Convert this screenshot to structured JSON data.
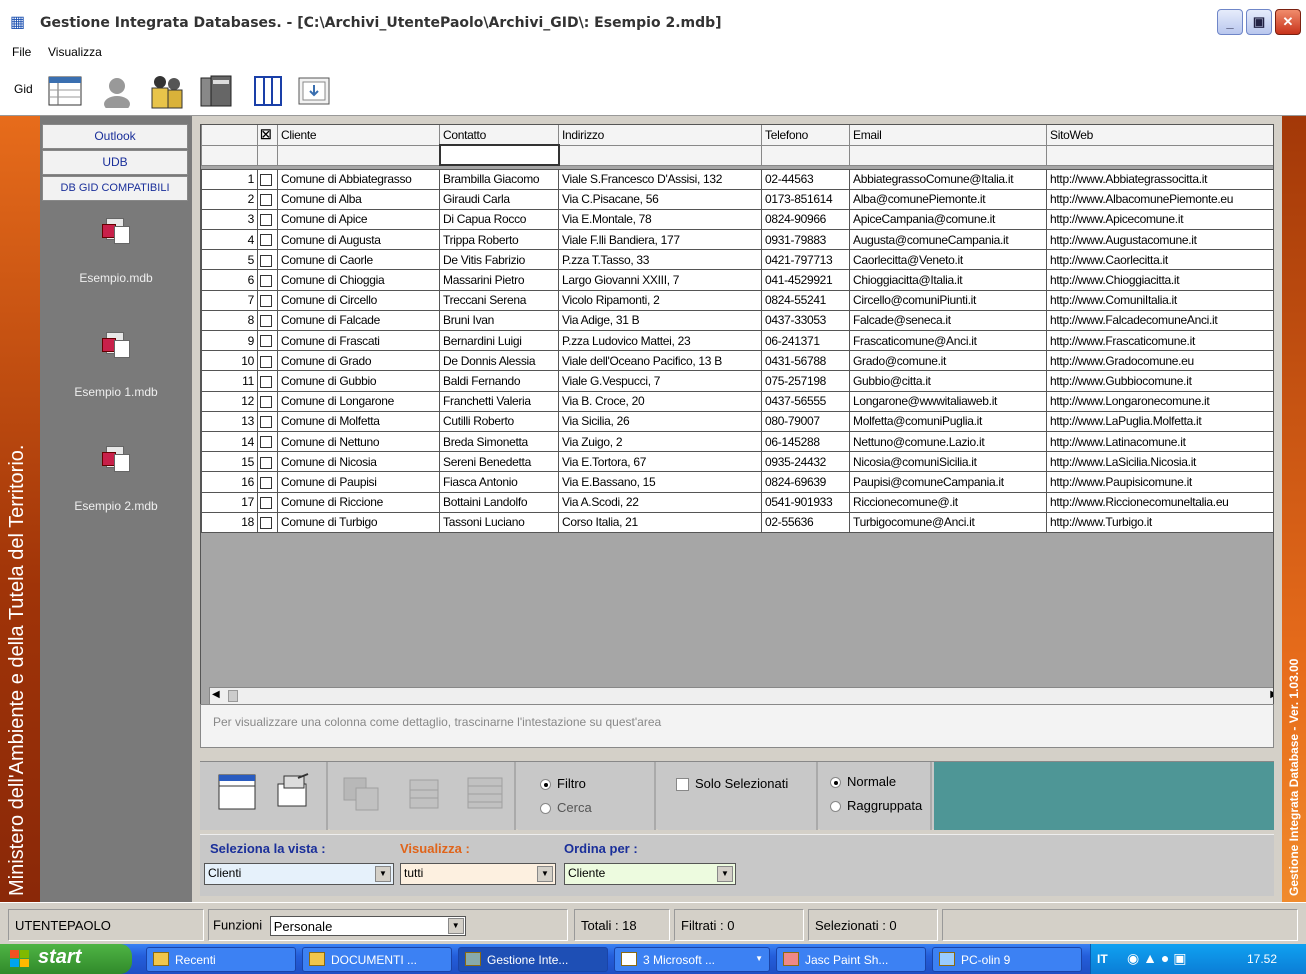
{
  "window": {
    "title": "Gestione Integrata Databases. - [C:\\Archivi_UtentePaolo\\Archivi_GID\\: Esempio 2.mdb]",
    "minimize": "_",
    "restore": "▣",
    "close": "✕"
  },
  "menu": [
    "File",
    "Visualizza"
  ],
  "toolbar": {
    "gid": "Gid"
  },
  "left_band": "Ministero dell'Ambiente e della Tutela del Territorio.",
  "right_band": "Gestione Integrata Database - Ver. 1.03.00",
  "sidebar": {
    "tabs": [
      "Outlook",
      "UDB",
      "DB GID COMPATIBILI"
    ],
    "files": [
      "Esempio.mdb",
      "Esempio 1.mdb",
      "Esempio 2.mdb"
    ]
  },
  "grid": {
    "columns": [
      "Cliente",
      "Contatto",
      "Indirizzo",
      "Telefono",
      "Email",
      "SitoWeb"
    ],
    "rows": [
      [
        "1",
        "Comune di Abbiategrasso",
        "Brambilla Giacomo",
        "Viale S.Francesco D'Assisi, 132",
        "02-44563",
        "AbbiategrassoComune@Italia.it",
        "http://www.Abbiategrassocitta.it"
      ],
      [
        "2",
        "Comune di Alba",
        "Giraudi Carla",
        "Via C.Pisacane, 56",
        "0173-851614",
        "Alba@comunePiemonte.it",
        "http://www.AlbacomunePiemonte.eu"
      ],
      [
        "3",
        "Comune di Apice",
        "Di Capua Rocco",
        "Via E.Montale, 78",
        "0824-90966",
        "ApiceCampania@comune.it",
        "http://www.Apicecomune.it"
      ],
      [
        "4",
        "Comune di Augusta",
        "Trippa Roberto",
        "Viale F.lli Bandiera, 177",
        "0931-79883",
        "Augusta@comuneCampania.it",
        "http://www.Augustacomune.it"
      ],
      [
        "5",
        "Comune di Caorle",
        "De Vitis Fabrizio",
        "P.zza T.Tasso, 33",
        "0421-797713",
        "Caorlecitta@Veneto.it",
        "http://www.Caorlecitta.it"
      ],
      [
        "6",
        "Comune di Chioggia",
        "Massarini Pietro",
        "Largo Giovanni XXIII, 7",
        "041-4529921",
        "Chioggiacitta@Italia.it",
        "http://www.Chioggiacitta.it"
      ],
      [
        "7",
        "Comune di Circello",
        "Treccani Serena",
        "Vicolo Ripamonti, 2",
        "0824-55241",
        "Circello@comuniPiunti.it",
        "http://www.ComuniItalia.it"
      ],
      [
        "8",
        "Comune di Falcade",
        "Bruni Ivan",
        "Via Adige, 31 B",
        "0437-33053",
        "Falcade@seneca.it",
        "http://www.FalcadecomuneAnci.it"
      ],
      [
        "9",
        "Comune di Frascati",
        "Bernardini Luigi",
        "P.zza Ludovico Mattei, 23",
        "06-241371",
        "Frascaticomune@Anci.it",
        "http://www.Frascaticomune.it"
      ],
      [
        "10",
        "Comune di Grado",
        "De Donnis Alessia",
        "Viale dell'Oceano Pacifico, 13 B",
        "0431-56788",
        "Grado@comune.it",
        "http://www.Gradocomune.eu"
      ],
      [
        "11",
        "Comune di Gubbio",
        "Baldi Fernando",
        "Viale G.Vespucci, 7",
        "075-257198",
        "Gubbio@citta.it",
        "http://www.Gubbiocomune.it"
      ],
      [
        "12",
        "Comune di Longarone",
        "Franchetti Valeria",
        "Via B. Croce, 20",
        "0437-56555",
        "Longarone@wwwitaliaweb.it",
        "http://www.Longaronecomune.it"
      ],
      [
        "13",
        "Comune di Molfetta",
        "Cutilli Roberto",
        "Via Sicilia, 26",
        "080-79007",
        "Molfetta@comuniPuglia.it",
        "http://www.LaPuglia.Molfetta.it"
      ],
      [
        "14",
        "Comune di Nettuno",
        "Breda Simonetta",
        "Via Zuigo, 2",
        "06-145288",
        "Nettuno@comune.Lazio.it",
        "http://www.Latinacomune.it"
      ],
      [
        "15",
        "Comune di Nicosia",
        "Sereni Benedetta",
        "Via E.Tortora, 67",
        "0935-24432",
        "Nicosia@comuniSicilia.it",
        "http://www.LaSicilia.Nicosia.it"
      ],
      [
        "16",
        "Comune di Paupisi",
        "Fiasca Antonio",
        "Via E.Bassano, 15",
        "0824-69639",
        "Paupisi@comuneCampania.it",
        "http://www.Paupisicomune.it"
      ],
      [
        "17",
        "Comune di Riccione",
        "Bottaini Landolfo",
        "Via A.Scodi, 22",
        "0541-901933",
        "Riccionecomune@.it",
        "http://www.Riccionecomuneltalia.eu"
      ],
      [
        "18",
        "Comune di Turbigo",
        "Tassoni Luciano",
        "Corso Italia, 21",
        "02-55636",
        "Turbigocomune@Anci.it",
        "http://www.Turbigo.it"
      ]
    ]
  },
  "group_hint": "Per visualizzare una colonna come dettaglio, trascinarne l'intestazione su quest'area",
  "controls": {
    "filtro": "Filtro",
    "cerca": "Cerca",
    "solo": "Solo Selezionati",
    "normale": "Normale",
    "raggruppata": "Raggruppata"
  },
  "view": {
    "seleziona_label": "Seleziona la vista :",
    "seleziona_value": "Clienti",
    "visualizza_label": "Visualizza :",
    "visualizza_value": "tutti",
    "ordina_label": "Ordina per :",
    "ordina_value": "Cliente"
  },
  "colors": {
    "accent_blue": "#1a2f9a",
    "accent_orange": "#e0641a",
    "teal": "#4e9696"
  },
  "status": {
    "user": "UTENTEPAOLO",
    "funzioni_label": "Funzioni",
    "funzioni_value": "Personale",
    "totali": "Totali :  18",
    "filtrati": "Filtrati :  0",
    "selezionati": "Selezionati :  0"
  },
  "taskbar": {
    "start": "start",
    "tasks": [
      "Recenti",
      "DOCUMENTI ...",
      "Gestione Inte...",
      "3 Microsoft ...",
      "Jasc Paint Sh...",
      "PC-olin 9"
    ],
    "lang": "IT",
    "time": "17.52"
  }
}
